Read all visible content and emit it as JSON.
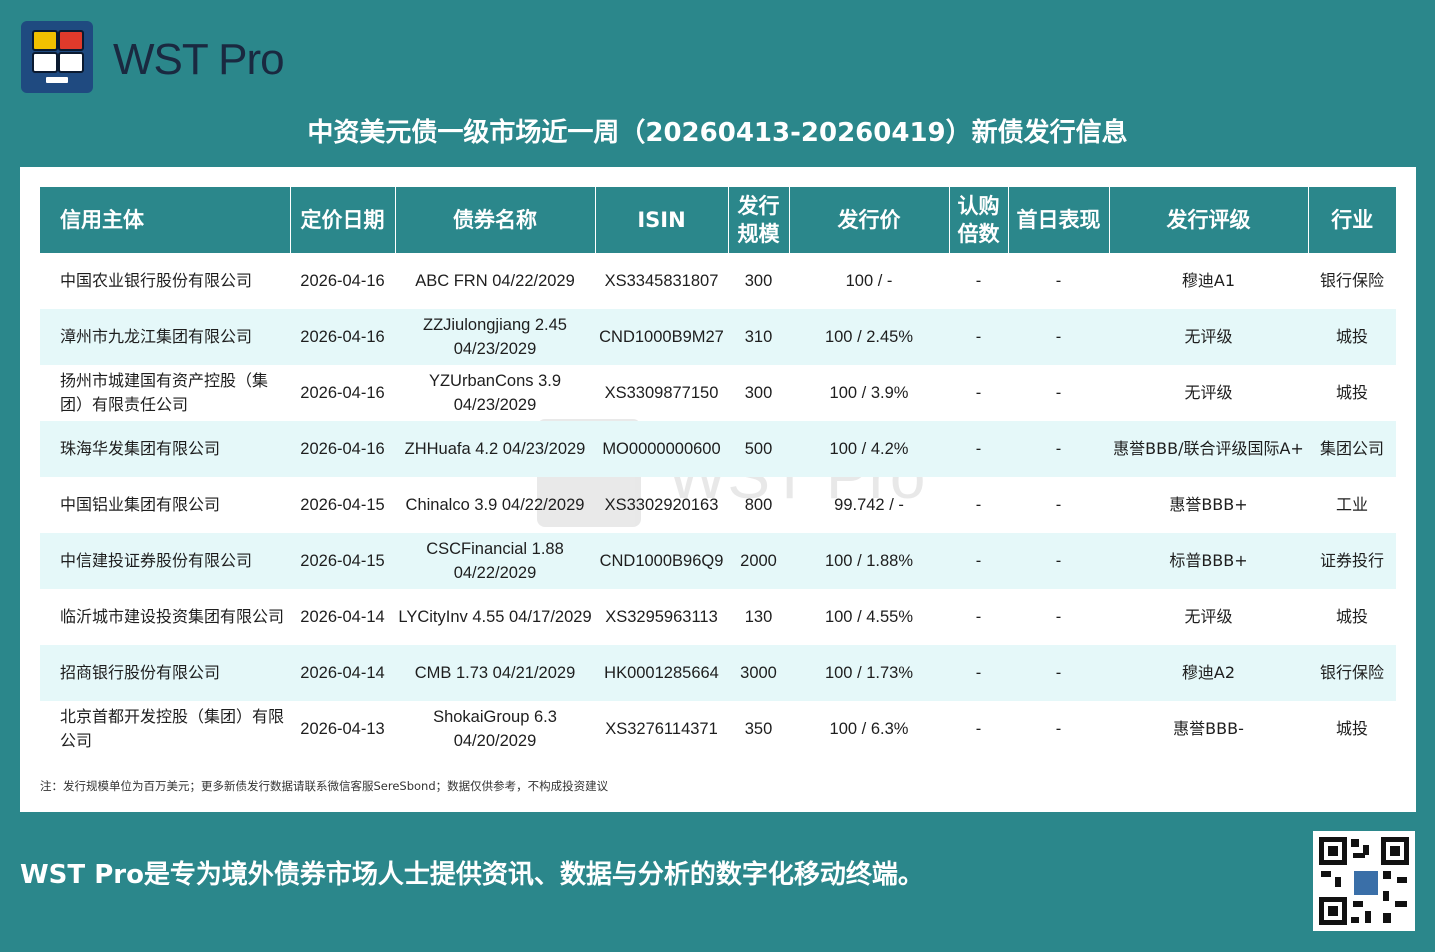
{
  "brand": {
    "name": "WST Pro",
    "icon": "wst-logo-icon"
  },
  "title": "中资美元债一级市场近一周（20260413-20260419）新债发行信息",
  "table": {
    "headers": [
      "信用主体",
      "定价日期",
      "债券名称",
      "ISIN",
      "发行规模",
      "发行价",
      "认购倍数",
      "首日表现",
      "发行评级",
      "行业"
    ],
    "rows": [
      [
        "中国农业银行股份有限公司",
        "2026-04-16",
        "ABC FRN 04/22/2029",
        "XS3345831807",
        "300",
        "100 / -",
        "-",
        "-",
        "穆迪A1",
        "银行保险"
      ],
      [
        "漳州市九龙江集团有限公司",
        "2026-04-16",
        "ZZJiulongjiang 2.45 04/23/2029",
        "CND1000B9M27",
        "310",
        "100 / 2.45%",
        "-",
        "-",
        "无评级",
        "城投"
      ],
      [
        "扬州市城建国有资产控股（集团）有限责任公司",
        "2026-04-16",
        "YZUrbanCons 3.9 04/23/2029",
        "XS3309877150",
        "300",
        "100 / 3.9%",
        "-",
        "-",
        "无评级",
        "城投"
      ],
      [
        "珠海华发集团有限公司",
        "2026-04-16",
        "ZHHuafa 4.2 04/23/2029",
        "MO0000000600",
        "500",
        "100 / 4.2%",
        "-",
        "-",
        "惠誉BBB/联合评级国际A+",
        "集团公司"
      ],
      [
        "中国铝业集团有限公司",
        "2026-04-15",
        "Chinalco 3.9 04/22/2029",
        "XS3302920163",
        "800",
        "99.742 / -",
        "-",
        "-",
        "惠誉BBB+",
        "工业"
      ],
      [
        "中信建投证券股份有限公司",
        "2026-04-15",
        "CSCFinancial 1.88 04/22/2029",
        "CND1000B96Q9",
        "2000",
        "100 / 1.88%",
        "-",
        "-",
        "标普BBB+",
        "证券投行"
      ],
      [
        "临沂城市建设投资集团有限公司",
        "2026-04-14",
        "LYCityInv 4.55 04/17/2029",
        "XS3295963113",
        "130",
        "100 / 4.55%",
        "-",
        "-",
        "无评级",
        "城投"
      ],
      [
        "招商银行股份有限公司",
        "2026-04-14",
        "CMB 1.73 04/21/2029",
        "HK0001285664",
        "3000",
        "100 / 1.73%",
        "-",
        "-",
        "穆迪A2",
        "银行保险"
      ],
      [
        "北京首都开发控股（集团）有限公司",
        "2026-04-13",
        "ShokaiGroup 6.3 04/20/2029",
        "XS3276114371",
        "350",
        "100 / 6.3%",
        "-",
        "-",
        "惠誉BBB-",
        "城投"
      ]
    ]
  },
  "note": "注：发行规模单位为百万美元；更多新债发行数据请联系微信客服SereSbond；数据仅供参考，不构成投资建议",
  "watermark": "WST Pro",
  "slogan": "WST Pro是专为境外债券市场人士提供资讯、数据与分析的数字化移动终端。",
  "qr_icon": "qr-code-icon",
  "colors": {
    "background": "#2b878b",
    "header": "#2b878b",
    "row_alt": "#e5f8f9",
    "logo_bg": "#1f4a80"
  }
}
